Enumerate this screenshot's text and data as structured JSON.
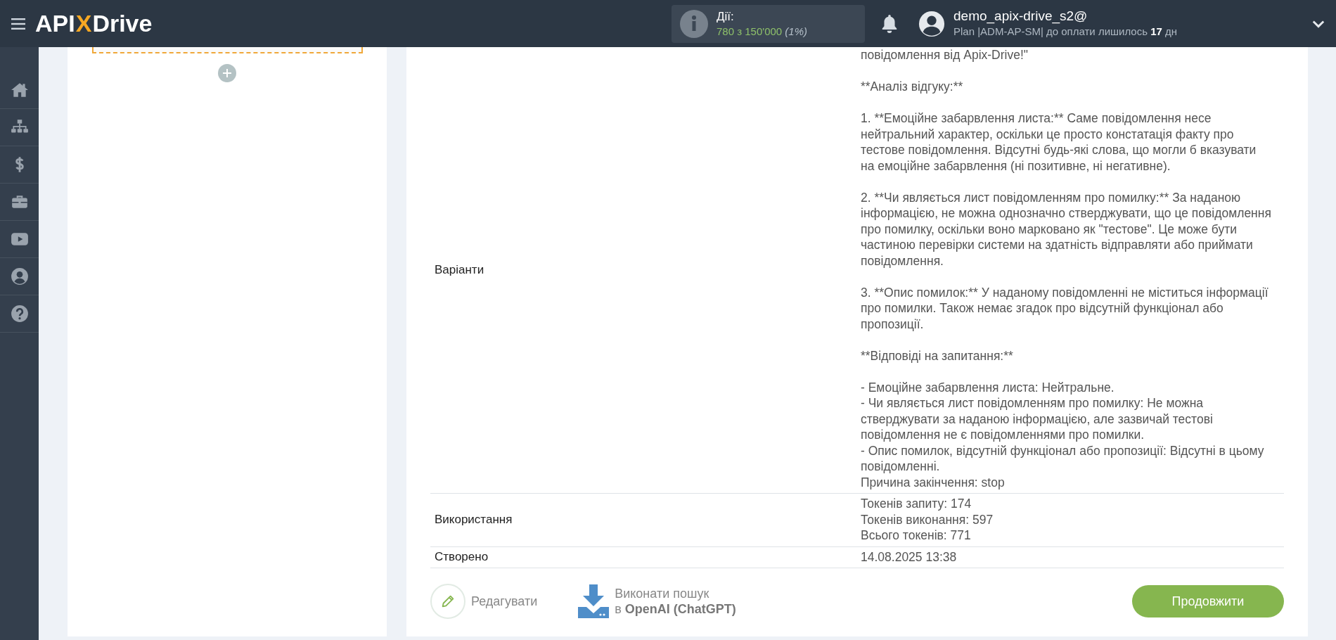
{
  "header": {
    "logo": {
      "left": "API",
      "mark": "X",
      "right": "Drive"
    },
    "actions": {
      "label": "Дії:",
      "used": "780",
      "of": "з 150'000",
      "percent": "(1%)"
    },
    "user": {
      "name": "demo_apix-drive_s2@",
      "plan": "Plan |ADM-AP-SM| до оплати лишилось **17** дн"
    }
  },
  "sidebar": {
    "items": [
      {
        "kind": "home",
        "selected": false
      },
      {
        "kind": "sitemap",
        "selected": false
      },
      {
        "kind": "dollar",
        "selected": false
      },
      {
        "kind": "briefcase",
        "selected": false
      },
      {
        "kind": "video",
        "selected": false
      },
      {
        "kind": "user",
        "selected": false
      },
      {
        "kind": "help",
        "selected": false
      }
    ]
  },
  "result": {
    "rows": [
      {
        "label": "Варіанти",
        "paragraphs": [
          "повідомлення від Apix-Drive!\"",
          "**Аналіз відгуку:**",
          "1. **Емоційне забарвлення листа:** Саме повідомлення несе нейтральний характер, оскільки це просто констатація факту про тестове повідомлення. Відсутні будь-які слова, що могли б вказувати на емоційне забарвлення (ні позитивне, ні негативне).",
          "2. **Чи являється лист повідомленням про помилку:** За наданою інформацією, не можна однозначно стверджувати, що це повідомлення про помилку, оскільки воно марковано як \"тестове\". Це може бути частиною перевірки системи на здатність відправляти або приймати повідомлення.",
          "3. **Опис помилок:** У наданому повідомленні не міститься інформації про помилки. Також немає згадок про відсутній функціонал або пропозиції.",
          "**Відповіді на запитання:**",
          [
            "- Емоційне забарвлення листа: Нейтральне.",
            "- Чи являється лист повідомленням про помилку: Не можна стверджувати за наданою інформацією, але зазвичай тестові повідомлення не є повідомленнями про помилки.",
            "- Опис помилок, відсутній функціонал або пропозиції: Відсутні в цьому повідомленні.",
            "Причина закінчення: stop"
          ]
        ]
      },
      {
        "label": "Використання",
        "paragraphs": [
          [
            "Токенів запиту: 174",
            "Токенів виконання: 597",
            "Всього токенів: 771"
          ]
        ]
      },
      {
        "label": "Створено",
        "paragraphs": [
          [
            "14.08.2025 13:38"
          ]
        ]
      }
    ]
  },
  "actions": {
    "edit": "Редагувати",
    "search": {
      "line1": "Виконати пошук",
      "line2": "в **OpenAI (ChatGPT)**"
    },
    "continue": "Продовжити"
  }
}
